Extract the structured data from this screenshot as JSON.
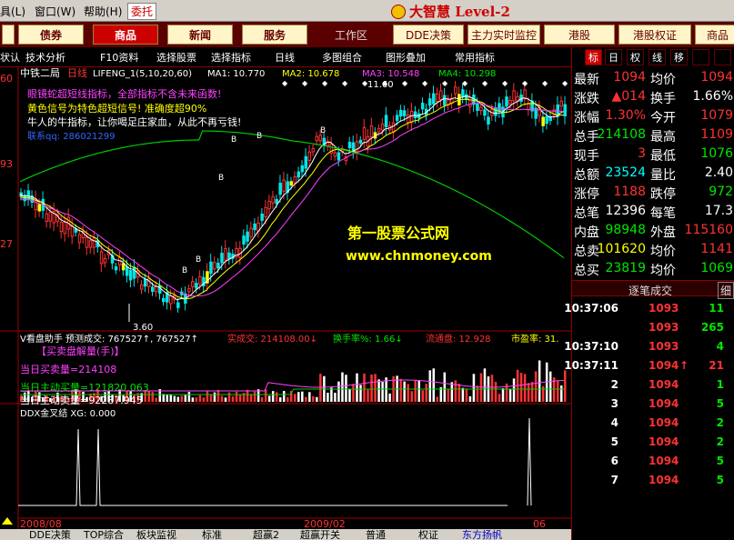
{
  "menu": {
    "items": [
      "具(L)",
      "窗口(W)",
      "帮助(H)",
      "委托"
    ],
    "brand": "大智慧 Level-2"
  },
  "nav": {
    "buttons": [
      "债券",
      "商品",
      "新闻",
      "服务"
    ],
    "workspace": "工作区",
    "right_buttons": [
      "DDE决策",
      "主力实时监控",
      "港股",
      "港股权证",
      "商品"
    ]
  },
  "toolbar": {
    "items": [
      "状认",
      "技术分析",
      "F10资料",
      "选择股票",
      "选择指标",
      "日线",
      "多图组合",
      "图形叠加",
      "常用指标"
    ]
  },
  "price_chart": {
    "stock_name": "中铁二局",
    "period": "日线",
    "indicator_line": "LIFENG_1(5,10,20,60)",
    "ma1_label": "MA1: 10.770",
    "ma2_label": "MA2: 10.678",
    "ma3_label": "MA3: 10.548",
    "ma4_label": "MA4: 10.298",
    "notes": [
      "眼镜蛇超短线指标，全部指标不含未来函数!",
      "黄色信号为特色超短信号! 准确度超90%",
      "牛人的牛指标，让你喝足庄家血，从此不再亏钱!"
    ],
    "extra_label": "联系qq: 286021299",
    "watermark_title": "第一股票公式网",
    "watermark_url": "www.chnmoney.com",
    "y_ticks": [
      "60",
      "93",
      "27"
    ],
    "high_mark": "11.60",
    "low_mark": "3.60",
    "buy_marks": [
      "B",
      "B",
      "B",
      "B",
      "B",
      "B"
    ]
  },
  "volume_chart": {
    "title": "V看盘助手 预测成交: 767527↑, 767527↑",
    "actual": "实成交: 214108.00↓",
    "turnover": "换手率%: 1.66↓",
    "float_cap": "流通盘: 12.928",
    "pe": "市盈率: 31.",
    "section_title": "【买卖盘解量(手)】",
    "buy_volume": "当日买卖量=214108",
    "active_buy": "当日主动买量=121820.063",
    "active_sell": "当日主动卖量=92287.945"
  },
  "ddx_chart": {
    "title": "DDX金叉结 XG: 0.000"
  },
  "time_axis": [
    "2008/08",
    "2009/02",
    "06"
  ],
  "bottom_tabs": [
    "DDE决策",
    "TOP综合",
    "板块监视",
    "标准",
    "超赢2",
    "超赢开关",
    "普通",
    "权证",
    "东方扬帆"
  ],
  "right_tabs": [
    "标",
    "日",
    "权",
    "线",
    "移"
  ],
  "quote": {
    "rows": [
      {
        "l1": "最新",
        "v1": "1094",
        "l2": "均价",
        "v2": "1094"
      },
      {
        "l1": "涨跌",
        "v1": "▲014",
        "l2": "换手",
        "v2": "1.66%"
      },
      {
        "l1": "涨幅",
        "v1": "1.30%",
        "l2": "今开",
        "v2": "1079"
      },
      {
        "l1": "总手",
        "v1": "214108",
        "l2": "最高",
        "v2": "1109"
      },
      {
        "l1": "现手",
        "v1": "3",
        "l2": "最低",
        "v2": "1076"
      },
      {
        "l1": "总额",
        "v1": "23524",
        "l2": "量比",
        "v2": "2.40"
      },
      {
        "l1": "涨停",
        "v1": "1188",
        "l2": "跌停",
        "v2": "972"
      },
      {
        "l1": "总笔",
        "v1": "12396",
        "l2": "每笔",
        "v2": "17.3"
      },
      {
        "l1": "内盘",
        "v1": "98948",
        "l2": "外盘",
        "v2": "115160"
      },
      {
        "l1": "总卖",
        "v1": "101620",
        "l2": "均价",
        "v2": "1141"
      },
      {
        "l1": "总买",
        "v1": "23819",
        "l2": "均价",
        "v2": "1069"
      }
    ]
  },
  "ticks": {
    "title": "逐笔成交",
    "extra": "细",
    "rows": [
      {
        "time": "10:37:06",
        "price": "1093",
        "vol": "11",
        "arrow": ""
      },
      {
        "time": "",
        "price": "1093",
        "vol": "265",
        "arrow": ""
      },
      {
        "time": "10:37:10",
        "price": "1093",
        "vol": "4",
        "arrow": ""
      },
      {
        "time": "10:37:11",
        "price": "1094",
        "vol": "21",
        "arrow": "↑"
      },
      {
        "time": "2",
        "price": "1094",
        "vol": "1",
        "arrow": ""
      },
      {
        "time": "3",
        "price": "1094",
        "vol": "5",
        "arrow": ""
      },
      {
        "time": "4",
        "price": "1094",
        "vol": "2",
        "arrow": ""
      },
      {
        "time": "5",
        "price": "1094",
        "vol": "2",
        "arrow": ""
      },
      {
        "time": "6",
        "price": "1094",
        "vol": "5",
        "arrow": ""
      },
      {
        "time": "7",
        "price": "1094",
        "vol": "5",
        "arrow": ""
      }
    ]
  },
  "colors": {
    "up": "#ff3232",
    "down": "#00e600",
    "accent": "#c00000",
    "yellow": "#ffff00"
  }
}
